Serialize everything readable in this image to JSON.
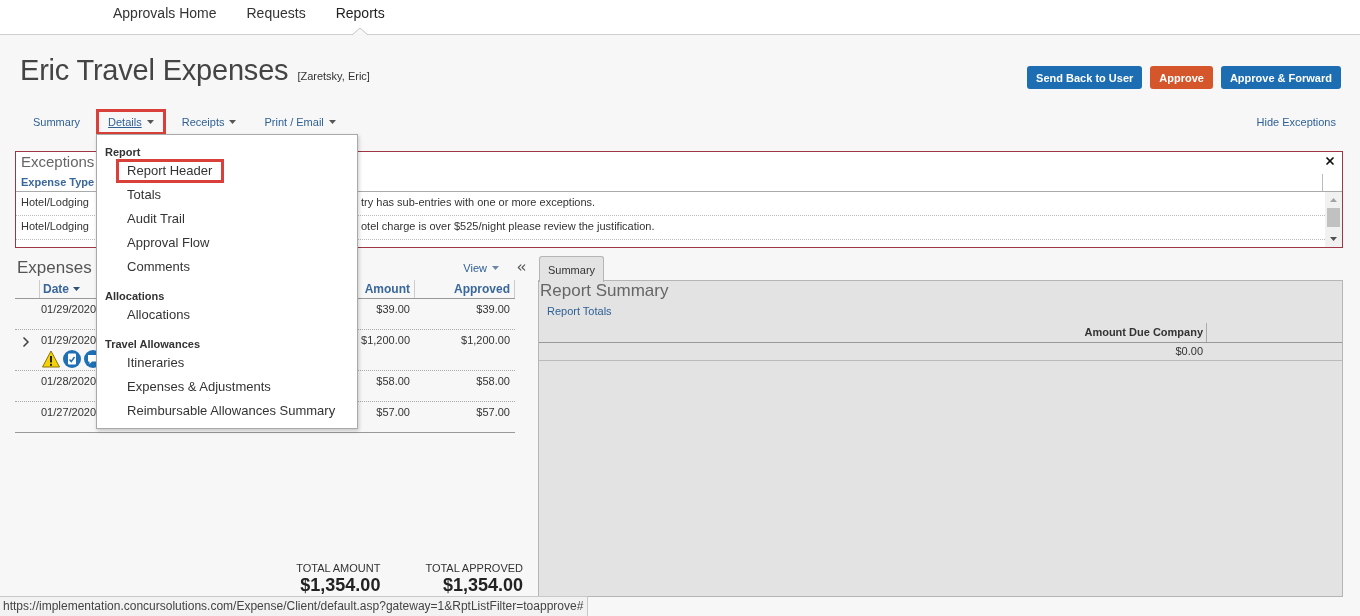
{
  "top_nav": {
    "items": [
      {
        "label": "Approvals Home",
        "selected": false
      },
      {
        "label": "Requests",
        "selected": false
      },
      {
        "label": "Reports",
        "selected": true
      }
    ]
  },
  "report": {
    "title": "Eric Travel Expenses",
    "owner": "[Zaretsky, Eric]"
  },
  "actions": [
    {
      "label": "Send Back to User",
      "kind": "primary"
    },
    {
      "label": "Approve",
      "kind": "accent"
    },
    {
      "label": "Approve & Forward",
      "kind": "primary"
    }
  ],
  "tabs": [
    {
      "label": "Summary",
      "has_menu": false,
      "expanded": false,
      "highlighted": false
    },
    {
      "label": "Details",
      "has_menu": true,
      "expanded": true,
      "highlighted": true
    },
    {
      "label": "Receipts",
      "has_menu": true,
      "expanded": false,
      "highlighted": false
    },
    {
      "label": "Print / Email",
      "has_menu": true,
      "expanded": false,
      "highlighted": false
    }
  ],
  "hide_exceptions": "Hide Exceptions",
  "details_menu": {
    "groups": [
      {
        "heading": "Report",
        "items": [
          {
            "label": "Report Header",
            "highlighted": true
          },
          {
            "label": "Totals",
            "highlighted": false
          },
          {
            "label": "Audit Trail",
            "highlighted": false
          },
          {
            "label": "Approval Flow",
            "highlighted": false
          },
          {
            "label": "Comments",
            "highlighted": false
          }
        ]
      },
      {
        "heading": "Allocations",
        "items": [
          {
            "label": "Allocations",
            "highlighted": false
          }
        ]
      },
      {
        "heading": "Travel Allowances",
        "items": [
          {
            "label": "Itineraries",
            "highlighted": false
          },
          {
            "label": "Expenses & Adjustments",
            "highlighted": false
          },
          {
            "label": "Reimbursable Allowances Summary",
            "highlighted": false
          }
        ]
      }
    ]
  },
  "exceptions": {
    "title": "Exceptions",
    "columns": [
      "Expense Type"
    ],
    "rows": [
      {
        "expense_type": "Hotel/Lodging",
        "message": "try has sub-entries with one or more exceptions."
      },
      {
        "expense_type": "Hotel/Lodging",
        "message": "otel charge is over $525/night please review the justification."
      }
    ]
  },
  "expenses": {
    "title": "Expenses",
    "view_label": "View",
    "columns": [
      {
        "label": "Date",
        "sorted": true
      },
      {
        "label": "Amount",
        "sorted": false
      },
      {
        "label": "Approved",
        "sorted": false
      }
    ],
    "rows": [
      {
        "date": "01/29/2020",
        "amount": "$39.00",
        "approved": "$39.00",
        "expandable": false,
        "flags": []
      },
      {
        "date": "01/29/2020",
        "amount": "$1,200.00",
        "approved": "$1,200.00",
        "expandable": true,
        "flags": [
          {
            "kind": "exception"
          },
          {
            "kind": "receipt"
          },
          {
            "kind": "comment"
          }
        ]
      },
      {
        "date": "01/28/2020",
        "amount": "$58.00",
        "approved": "$58.00",
        "expandable": false,
        "flags": []
      },
      {
        "date": "01/27/2020",
        "amount": "$57.00",
        "approved": "$57.00",
        "expandable": false,
        "flags": []
      }
    ],
    "totals": [
      {
        "label": "TOTAL AMOUNT",
        "value": "$1,354.00"
      },
      {
        "label": "TOTAL APPROVED",
        "value": "$1,354.00"
      }
    ]
  },
  "summary_panel": {
    "tabs": [
      {
        "label": "Summary",
        "selected": true
      }
    ],
    "title": "Report Summary",
    "link": "Report Totals",
    "columns": [
      "Amount Due Company"
    ],
    "rows": [
      [
        "$0.00"
      ]
    ]
  },
  "status_bar": {
    "url": "https://implementation.concursolutions.com/Expense/Client/default.asp?gateway=1&RptListFilter=toapprove#"
  }
}
